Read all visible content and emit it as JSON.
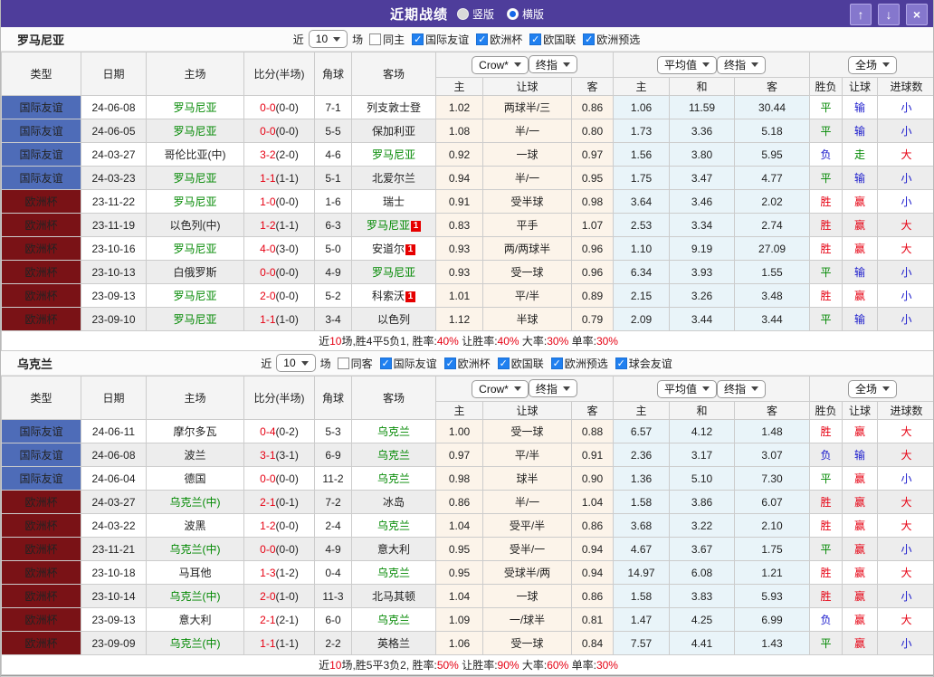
{
  "titlebar": {
    "title": "近期战绩",
    "modes": [
      {
        "label": "竖版",
        "selected": false
      },
      {
        "label": "横版",
        "selected": true
      }
    ],
    "icons": {
      "up": "↑",
      "down": "↓",
      "close": "×"
    }
  },
  "colors": {
    "accent_purple": "#4e3d9b",
    "button_purple": "#8577cd",
    "type_blue": "#4e6cb8",
    "type_red": "#7a1216",
    "focus_green": "#008800",
    "score_red": "#e60012",
    "result_red": "#e60012",
    "result_green": "#008800",
    "result_blue": "#1a1acc",
    "crown_bg": "#fcf4ea",
    "avg_bg": "#e9f4f9"
  },
  "result_colors": {
    "胜": "#e60012",
    "平": "#008800",
    "负": "#1a1acc",
    "赢": "#e60012",
    "输": "#1a1acc",
    "走": "#008800",
    "大": "#e60012",
    "小": "#1a1acc"
  },
  "table_header": {
    "cols": [
      "类型",
      "日期",
      "主场",
      "比分(半场)",
      "角球",
      "客场"
    ],
    "odds_groups": [
      {
        "selects": [
          "Crow*",
          "终指"
        ],
        "sub": [
          "主",
          "让球",
          "客"
        ]
      },
      {
        "selects": [
          "平均值",
          "终指"
        ],
        "sub": [
          "主",
          "和",
          "客"
        ]
      },
      {
        "selects": [
          "全场"
        ],
        "sub": [
          "胜负",
          "让球",
          "进球数"
        ]
      }
    ]
  },
  "sections": [
    {
      "team": "罗马尼亚",
      "filter": {
        "near": "近",
        "count": "10",
        "games": "场",
        "venue": {
          "label": "同主",
          "checked": false
        },
        "competitions": [
          {
            "label": "国际友谊",
            "checked": true
          },
          {
            "label": "欧洲杯",
            "checked": true
          },
          {
            "label": "欧国联",
            "checked": true
          },
          {
            "label": "欧洲预选",
            "checked": true
          }
        ]
      },
      "rows": [
        {
          "type": "国际友谊",
          "type_style": "blue",
          "date": "24-06-08",
          "home": "罗马尼亚",
          "home_focus": true,
          "home_badge": "",
          "score_ft": "0-0",
          "score_ht": "(0-0)",
          "corner": "7-1",
          "away": "列支敦士登",
          "away_focus": false,
          "away_badge": "",
          "crown": [
            "1.02",
            "两球半/三",
            "0.86"
          ],
          "avg": [
            "1.06",
            "11.59",
            "30.44"
          ],
          "results": [
            "平",
            "输",
            "小"
          ]
        },
        {
          "type": "国际友谊",
          "type_style": "blue",
          "date": "24-06-05",
          "home": "罗马尼亚",
          "home_focus": true,
          "home_badge": "",
          "score_ft": "0-0",
          "score_ht": "(0-0)",
          "corner": "5-5",
          "away": "保加利亚",
          "away_focus": false,
          "away_badge": "",
          "crown": [
            "1.08",
            "半/一",
            "0.80"
          ],
          "avg": [
            "1.73",
            "3.36",
            "5.18"
          ],
          "results": [
            "平",
            "输",
            "小"
          ]
        },
        {
          "type": "国际友谊",
          "type_style": "blue",
          "date": "24-03-27",
          "home": "哥伦比亚(中)",
          "home_focus": false,
          "home_badge": "",
          "score_ft": "3-2",
          "score_ht": "(2-0)",
          "corner": "4-6",
          "away": "罗马尼亚",
          "away_focus": true,
          "away_badge": "",
          "crown": [
            "0.92",
            "一球",
            "0.97"
          ],
          "avg": [
            "1.56",
            "3.80",
            "5.95"
          ],
          "results": [
            "负",
            "走",
            "大"
          ]
        },
        {
          "type": "国际友谊",
          "type_style": "blue",
          "date": "24-03-23",
          "home": "罗马尼亚",
          "home_focus": true,
          "home_badge": "",
          "score_ft": "1-1",
          "score_ht": "(1-1)",
          "corner": "5-1",
          "away": "北爱尔兰",
          "away_focus": false,
          "away_badge": "",
          "crown": [
            "0.94",
            "半/一",
            "0.95"
          ],
          "avg": [
            "1.75",
            "3.47",
            "4.77"
          ],
          "results": [
            "平",
            "输",
            "小"
          ]
        },
        {
          "type": "欧洲杯",
          "type_style": "red",
          "date": "23-11-22",
          "home": "罗马尼亚",
          "home_focus": true,
          "home_badge": "",
          "score_ft": "1-0",
          "score_ht": "(0-0)",
          "corner": "1-6",
          "away": "瑞士",
          "away_focus": false,
          "away_badge": "",
          "crown": [
            "0.91",
            "受半球",
            "0.98"
          ],
          "avg": [
            "3.64",
            "3.46",
            "2.02"
          ],
          "results": [
            "胜",
            "赢",
            "小"
          ]
        },
        {
          "type": "欧洲杯",
          "type_style": "red",
          "date": "23-11-19",
          "home": "以色列(中)",
          "home_focus": false,
          "home_badge": "",
          "score_ft": "1-2",
          "score_ht": "(1-1)",
          "corner": "6-3",
          "away": "罗马尼亚",
          "away_focus": true,
          "away_badge": "1",
          "crown": [
            "0.83",
            "平手",
            "1.07"
          ],
          "avg": [
            "2.53",
            "3.34",
            "2.74"
          ],
          "results": [
            "胜",
            "赢",
            "大"
          ]
        },
        {
          "type": "欧洲杯",
          "type_style": "red",
          "date": "23-10-16",
          "home": "罗马尼亚",
          "home_focus": true,
          "home_badge": "",
          "score_ft": "4-0",
          "score_ht": "(3-0)",
          "corner": "5-0",
          "away": "安道尔",
          "away_focus": false,
          "away_badge": "1",
          "crown": [
            "0.93",
            "两/两球半",
            "0.96"
          ],
          "avg": [
            "1.10",
            "9.19",
            "27.09"
          ],
          "results": [
            "胜",
            "赢",
            "大"
          ]
        },
        {
          "type": "欧洲杯",
          "type_style": "red",
          "date": "23-10-13",
          "home": "白俄罗斯",
          "home_focus": false,
          "home_badge": "",
          "score_ft": "0-0",
          "score_ht": "(0-0)",
          "corner": "4-9",
          "away": "罗马尼亚",
          "away_focus": true,
          "away_badge": "",
          "crown": [
            "0.93",
            "受一球",
            "0.96"
          ],
          "avg": [
            "6.34",
            "3.93",
            "1.55"
          ],
          "results": [
            "平",
            "输",
            "小"
          ]
        },
        {
          "type": "欧洲杯",
          "type_style": "red",
          "date": "23-09-13",
          "home": "罗马尼亚",
          "home_focus": true,
          "home_badge": "",
          "score_ft": "2-0",
          "score_ht": "(0-0)",
          "corner": "5-2",
          "away": "科索沃",
          "away_focus": false,
          "away_badge": "1",
          "crown": [
            "1.01",
            "平/半",
            "0.89"
          ],
          "avg": [
            "2.15",
            "3.26",
            "3.48"
          ],
          "results": [
            "胜",
            "赢",
            "小"
          ]
        },
        {
          "type": "欧洲杯",
          "type_style": "red",
          "date": "23-09-10",
          "home": "罗马尼亚",
          "home_focus": true,
          "home_badge": "",
          "score_ft": "1-1",
          "score_ht": "(1-0)",
          "corner": "3-4",
          "away": "以色列",
          "away_focus": false,
          "away_badge": "",
          "crown": [
            "1.12",
            "半球",
            "0.79"
          ],
          "avg": [
            "2.09",
            "3.44",
            "3.44"
          ],
          "results": [
            "平",
            "输",
            "小"
          ]
        }
      ],
      "summary": [
        {
          "text": "近",
          "red": false
        },
        {
          "text": "10",
          "red": true
        },
        {
          "text": "场,胜4平5负1, 胜率:",
          "red": false
        },
        {
          "text": "40%",
          "red": true
        },
        {
          "text": " 让胜率:",
          "red": false
        },
        {
          "text": "40%",
          "red": true
        },
        {
          "text": " 大率:",
          "red": false
        },
        {
          "text": "30%",
          "red": true
        },
        {
          "text": " 单率:",
          "red": false
        },
        {
          "text": "30%",
          "red": true
        }
      ]
    },
    {
      "team": "乌克兰",
      "filter": {
        "near": "近",
        "count": "10",
        "games": "场",
        "venue": {
          "label": "同客",
          "checked": false
        },
        "competitions": [
          {
            "label": "国际友谊",
            "checked": true
          },
          {
            "label": "欧洲杯",
            "checked": true
          },
          {
            "label": "欧国联",
            "checked": true
          },
          {
            "label": "欧洲预选",
            "checked": true
          },
          {
            "label": "球会友谊",
            "checked": true
          }
        ]
      },
      "rows": [
        {
          "type": "国际友谊",
          "type_style": "blue",
          "date": "24-06-11",
          "home": "摩尔多瓦",
          "home_focus": false,
          "home_badge": "",
          "score_ft": "0-4",
          "score_ht": "(0-2)",
          "corner": "5-3",
          "away": "乌克兰",
          "away_focus": true,
          "away_badge": "",
          "crown": [
            "1.00",
            "受一球",
            "0.88"
          ],
          "avg": [
            "6.57",
            "4.12",
            "1.48"
          ],
          "results": [
            "胜",
            "赢",
            "大"
          ]
        },
        {
          "type": "国际友谊",
          "type_style": "blue",
          "date": "24-06-08",
          "home": "波兰",
          "home_focus": false,
          "home_badge": "",
          "score_ft": "3-1",
          "score_ht": "(3-1)",
          "corner": "6-9",
          "away": "乌克兰",
          "away_focus": true,
          "away_badge": "",
          "crown": [
            "0.97",
            "平/半",
            "0.91"
          ],
          "avg": [
            "2.36",
            "3.17",
            "3.07"
          ],
          "results": [
            "负",
            "输",
            "大"
          ]
        },
        {
          "type": "国际友谊",
          "type_style": "blue",
          "date": "24-06-04",
          "home": "德国",
          "home_focus": false,
          "home_badge": "",
          "score_ft": "0-0",
          "score_ht": "(0-0)",
          "corner": "11-2",
          "away": "乌克兰",
          "away_focus": true,
          "away_badge": "",
          "crown": [
            "0.98",
            "球半",
            "0.90"
          ],
          "avg": [
            "1.36",
            "5.10",
            "7.30"
          ],
          "results": [
            "平",
            "赢",
            "小"
          ]
        },
        {
          "type": "欧洲杯",
          "type_style": "red",
          "date": "24-03-27",
          "home": "乌克兰(中)",
          "home_focus": true,
          "home_badge": "",
          "score_ft": "2-1",
          "score_ht": "(0-1)",
          "corner": "7-2",
          "away": "冰岛",
          "away_focus": false,
          "away_badge": "",
          "crown": [
            "0.86",
            "半/一",
            "1.04"
          ],
          "avg": [
            "1.58",
            "3.86",
            "6.07"
          ],
          "results": [
            "胜",
            "赢",
            "大"
          ]
        },
        {
          "type": "欧洲杯",
          "type_style": "red",
          "date": "24-03-22",
          "home": "波黑",
          "home_focus": false,
          "home_badge": "",
          "score_ft": "1-2",
          "score_ht": "(0-0)",
          "corner": "2-4",
          "away": "乌克兰",
          "away_focus": true,
          "away_badge": "",
          "crown": [
            "1.04",
            "受平/半",
            "0.86"
          ],
          "avg": [
            "3.68",
            "3.22",
            "2.10"
          ],
          "results": [
            "胜",
            "赢",
            "大"
          ]
        },
        {
          "type": "欧洲杯",
          "type_style": "red",
          "date": "23-11-21",
          "home": "乌克兰(中)",
          "home_focus": true,
          "home_badge": "",
          "score_ft": "0-0",
          "score_ht": "(0-0)",
          "corner": "4-9",
          "away": "意大利",
          "away_focus": false,
          "away_badge": "",
          "crown": [
            "0.95",
            "受半/一",
            "0.94"
          ],
          "avg": [
            "4.67",
            "3.67",
            "1.75"
          ],
          "results": [
            "平",
            "赢",
            "小"
          ]
        },
        {
          "type": "欧洲杯",
          "type_style": "red",
          "date": "23-10-18",
          "home": "马耳他",
          "home_focus": false,
          "home_badge": "",
          "score_ft": "1-3",
          "score_ht": "(1-2)",
          "corner": "0-4",
          "away": "乌克兰",
          "away_focus": true,
          "away_badge": "",
          "crown": [
            "0.95",
            "受球半/两",
            "0.94"
          ],
          "avg": [
            "14.97",
            "6.08",
            "1.21"
          ],
          "results": [
            "胜",
            "赢",
            "大"
          ]
        },
        {
          "type": "欧洲杯",
          "type_style": "red",
          "date": "23-10-14",
          "home": "乌克兰(中)",
          "home_focus": true,
          "home_badge": "",
          "score_ft": "2-0",
          "score_ht": "(1-0)",
          "corner": "11-3",
          "away": "北马其顿",
          "away_focus": false,
          "away_badge": "",
          "crown": [
            "1.04",
            "一球",
            "0.86"
          ],
          "avg": [
            "1.58",
            "3.83",
            "5.93"
          ],
          "results": [
            "胜",
            "赢",
            "小"
          ]
        },
        {
          "type": "欧洲杯",
          "type_style": "red",
          "date": "23-09-13",
          "home": "意大利",
          "home_focus": false,
          "home_badge": "",
          "score_ft": "2-1",
          "score_ht": "(2-1)",
          "corner": "6-0",
          "away": "乌克兰",
          "away_focus": true,
          "away_badge": "",
          "crown": [
            "1.09",
            "一/球半",
            "0.81"
          ],
          "avg": [
            "1.47",
            "4.25",
            "6.99"
          ],
          "results": [
            "负",
            "赢",
            "大"
          ]
        },
        {
          "type": "欧洲杯",
          "type_style": "red",
          "date": "23-09-09",
          "home": "乌克兰(中)",
          "home_focus": true,
          "home_badge": "",
          "score_ft": "1-1",
          "score_ht": "(1-1)",
          "corner": "2-2",
          "away": "英格兰",
          "away_focus": false,
          "away_badge": "",
          "crown": [
            "1.06",
            "受一球",
            "0.84"
          ],
          "avg": [
            "7.57",
            "4.41",
            "1.43"
          ],
          "results": [
            "平",
            "赢",
            "小"
          ]
        }
      ],
      "summary": [
        {
          "text": "近",
          "red": false
        },
        {
          "text": "10",
          "red": true
        },
        {
          "text": "场,胜5平3负2, 胜率:",
          "red": false
        },
        {
          "text": "50%",
          "red": true
        },
        {
          "text": " 让胜率:",
          "red": false
        },
        {
          "text": "90%",
          "red": true
        },
        {
          "text": " 大率:",
          "red": false
        },
        {
          "text": "60%",
          "red": true
        },
        {
          "text": " 单率:",
          "red": false
        },
        {
          "text": "30%",
          "red": true
        }
      ]
    }
  ]
}
